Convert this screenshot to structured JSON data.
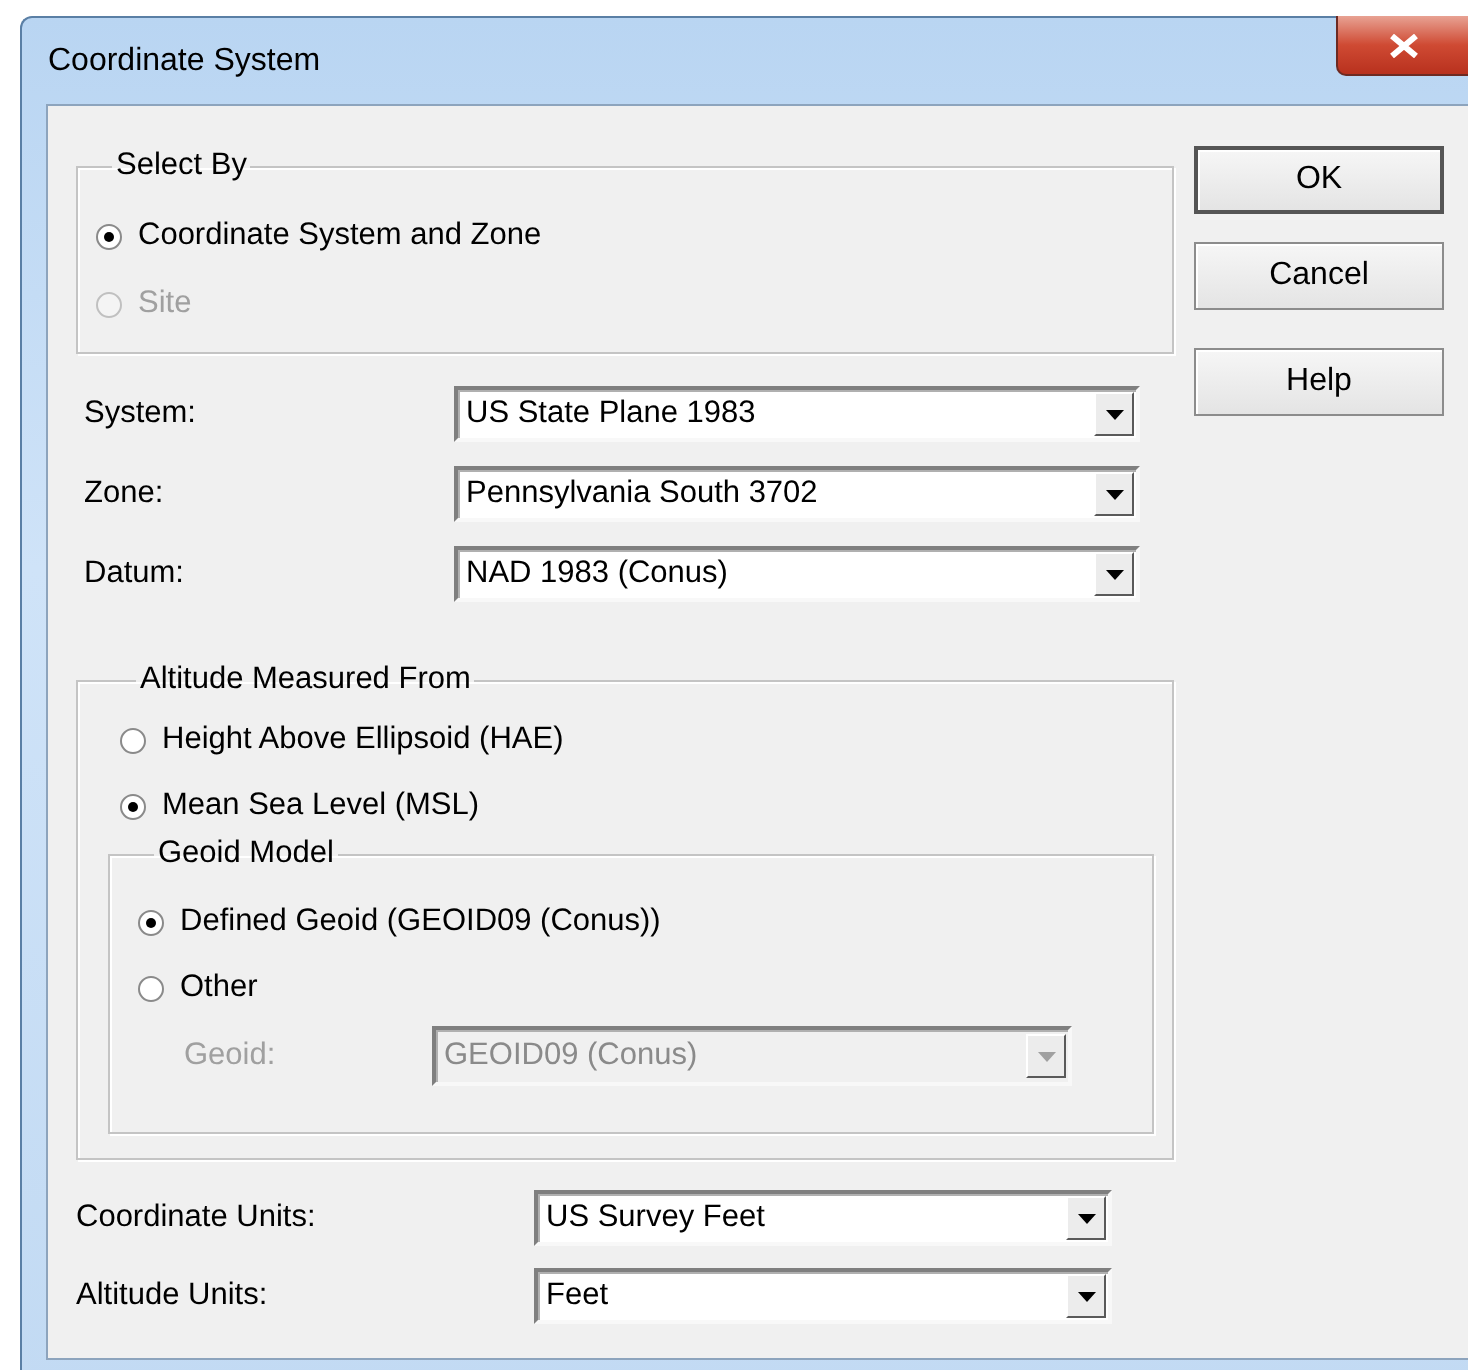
{
  "window": {
    "title": "Coordinate System"
  },
  "select_by": {
    "label": "Select By",
    "options": [
      {
        "label": "Coordinate System and Zone",
        "selected": true,
        "disabled": false
      },
      {
        "label": "Site",
        "selected": false,
        "disabled": true
      }
    ]
  },
  "fields": [
    {
      "label": "System:",
      "value": "US State Plane 1983"
    },
    {
      "label": "Zone:",
      "value": "Pennsylvania South 3702"
    },
    {
      "label": "Datum:",
      "value": "NAD 1983 (Conus)"
    }
  ],
  "altitude": {
    "label": "Altitude Measured From",
    "options": [
      {
        "label": "Height Above Ellipsoid (HAE)",
        "selected": false,
        "disabled": false
      },
      {
        "label": "Mean Sea Level (MSL)",
        "selected": true,
        "disabled": false
      }
    ],
    "geoid_model": {
      "label": "Geoid Model",
      "options": [
        {
          "label": "Defined Geoid (GEOID09 (Conus))",
          "selected": true,
          "disabled": false
        },
        {
          "label": "Other",
          "selected": false,
          "disabled": false
        }
      ],
      "geoid": {
        "label": "Geoid:",
        "value": "GEOID09 (Conus)",
        "disabled": true
      }
    }
  },
  "units": [
    {
      "label": "Coordinate Units:",
      "value": "US Survey Feet"
    },
    {
      "label": "Altitude Units:",
      "value": "Feet"
    }
  ],
  "buttons": [
    {
      "label": "OK",
      "default": true
    },
    {
      "label": "Cancel",
      "default": false
    },
    {
      "label": "Help",
      "default": false
    }
  ]
}
